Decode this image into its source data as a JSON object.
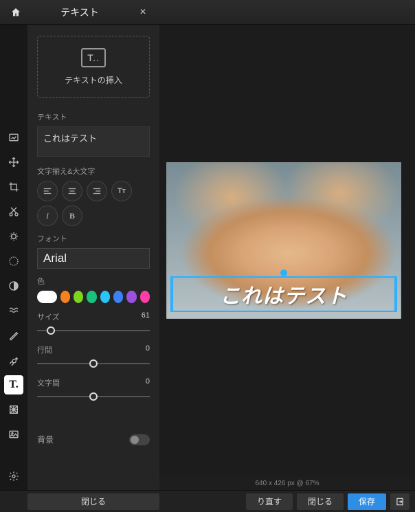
{
  "panel": {
    "title": "テキスト",
    "insert_label": "テキストの挿入",
    "text_label": "テキスト",
    "text_value": "これはテスト",
    "align_label": "文字揃え&大文字",
    "font_label": "フォント",
    "font_value": "Arial",
    "color_label": "色",
    "size_label": "サイズ",
    "size_value": "61",
    "line_label": "行間",
    "line_value": "0",
    "spacing_label": "文字間",
    "spacing_value": "0",
    "background_label": "背景",
    "close_label": "閉じる"
  },
  "swatches": [
    "#ffffff",
    "#f58220",
    "#7ed321",
    "#19c37d",
    "#29c5f6",
    "#3b82f6",
    "#9b51e0",
    "#ff3ea5"
  ],
  "canvas": {
    "overlay_text": "これはテスト",
    "info": "640 x 426 px @ 67%"
  },
  "bottom": {
    "redo": "り直す",
    "close": "閉じる",
    "save": "保存"
  },
  "tools": [
    "image",
    "move",
    "crop",
    "cut",
    "adjust",
    "effects",
    "filter",
    "liquify",
    "heal",
    "draw",
    "text",
    "pattern",
    "image-insert"
  ]
}
